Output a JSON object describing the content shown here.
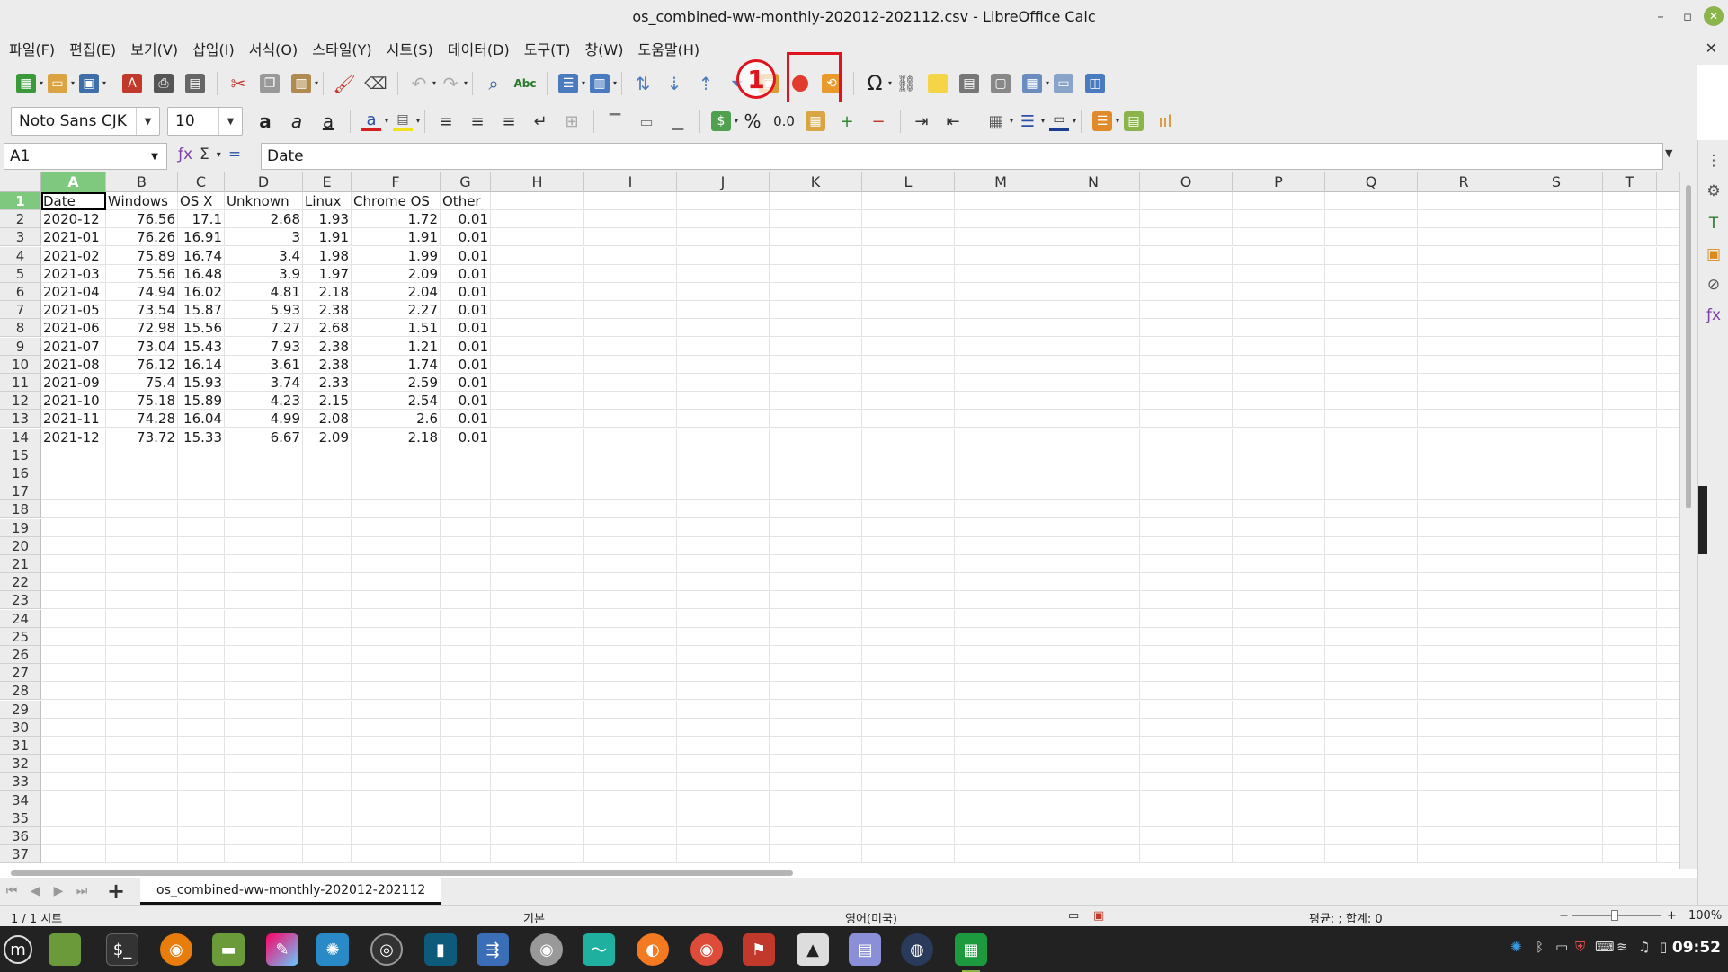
{
  "window": {
    "title": "os_combined-ww-monthly-202012-202112.csv - LibreOffice Calc"
  },
  "menu": [
    "파일(F)",
    "편집(E)",
    "보기(V)",
    "삽입(I)",
    "서식(O)",
    "스타일(Y)",
    "시트(S)",
    "데이터(D)",
    "도구(T)",
    "창(W)",
    "도움말(H)"
  ],
  "toolbar": {
    "font_name": "Noto Sans CJK",
    "font_size": "10",
    "percent_label": "%",
    "decimal_label": "0.0",
    "special_char_label": "Ω"
  },
  "annotation": {
    "step_label": "1"
  },
  "formula": {
    "cell_ref": "A1",
    "sigma_label": "Σ",
    "equals_label": "=",
    "value": "Date"
  },
  "columns": [
    "A",
    "B",
    "C",
    "D",
    "E",
    "F",
    "G",
    "H",
    "I",
    "J",
    "K",
    "L",
    "M",
    "N",
    "O",
    "P",
    "Q",
    "R",
    "S",
    "T"
  ],
  "sheet": {
    "rows": [
      [
        "Date",
        "Windows",
        "OS X",
        "Unknown",
        "Linux",
        "Chrome OS",
        "Other"
      ],
      [
        "2020-12",
        "76.56",
        "17.1",
        "2.68",
        "1.93",
        "1.72",
        "0.01"
      ],
      [
        "2021-01",
        "76.26",
        "16.91",
        "3",
        "1.91",
        "1.91",
        "0.01"
      ],
      [
        "2021-02",
        "75.89",
        "16.74",
        "3.4",
        "1.98",
        "1.99",
        "0.01"
      ],
      [
        "2021-03",
        "75.56",
        "16.48",
        "3.9",
        "1.97",
        "2.09",
        "0.01"
      ],
      [
        "2021-04",
        "74.94",
        "16.02",
        "4.81",
        "2.18",
        "2.04",
        "0.01"
      ],
      [
        "2021-05",
        "73.54",
        "15.87",
        "5.93",
        "2.38",
        "2.27",
        "0.01"
      ],
      [
        "2021-06",
        "72.98",
        "15.56",
        "7.27",
        "2.68",
        "1.51",
        "0.01"
      ],
      [
        "2021-07",
        "73.04",
        "15.43",
        "7.93",
        "2.38",
        "1.21",
        "0.01"
      ],
      [
        "2021-08",
        "76.12",
        "16.14",
        "3.61",
        "2.38",
        "1.74",
        "0.01"
      ],
      [
        "2021-09",
        "75.4",
        "15.93",
        "3.74",
        "2.33",
        "2.59",
        "0.01"
      ],
      [
        "2021-10",
        "75.18",
        "15.89",
        "4.23",
        "2.15",
        "2.54",
        "0.01"
      ],
      [
        "2021-11",
        "74.28",
        "16.04",
        "4.99",
        "2.08",
        "2.6",
        "0.01"
      ],
      [
        "2021-12",
        "73.72",
        "15.33",
        "6.67",
        "2.09",
        "2.18",
        "0.01"
      ]
    ],
    "row_numbers": [
      "1",
      "2",
      "3",
      "4",
      "5",
      "6",
      "7",
      "8",
      "9",
      "10",
      "11",
      "12",
      "13",
      "14",
      "15",
      "16",
      "17",
      "18",
      "19",
      "20",
      "21",
      "22",
      "23",
      "24",
      "25",
      "26",
      "27",
      "28",
      "29",
      "30",
      "31",
      "32",
      "33",
      "34",
      "35",
      "36",
      "37"
    ]
  },
  "tabs": {
    "sheet_name": "os_combined-ww-monthly-202012-202112"
  },
  "status": {
    "sheet_count": "1 / 1 시트",
    "page_style": "기본",
    "language": "영어(미국)",
    "summary": "평균: ; 합계: 0",
    "zoom": "100%"
  },
  "taskbar": {
    "clock": "09:52"
  },
  "colors": {
    "annotation": "#e0141e",
    "selected_header": "#7fc97f",
    "taskbar": "#222222"
  }
}
